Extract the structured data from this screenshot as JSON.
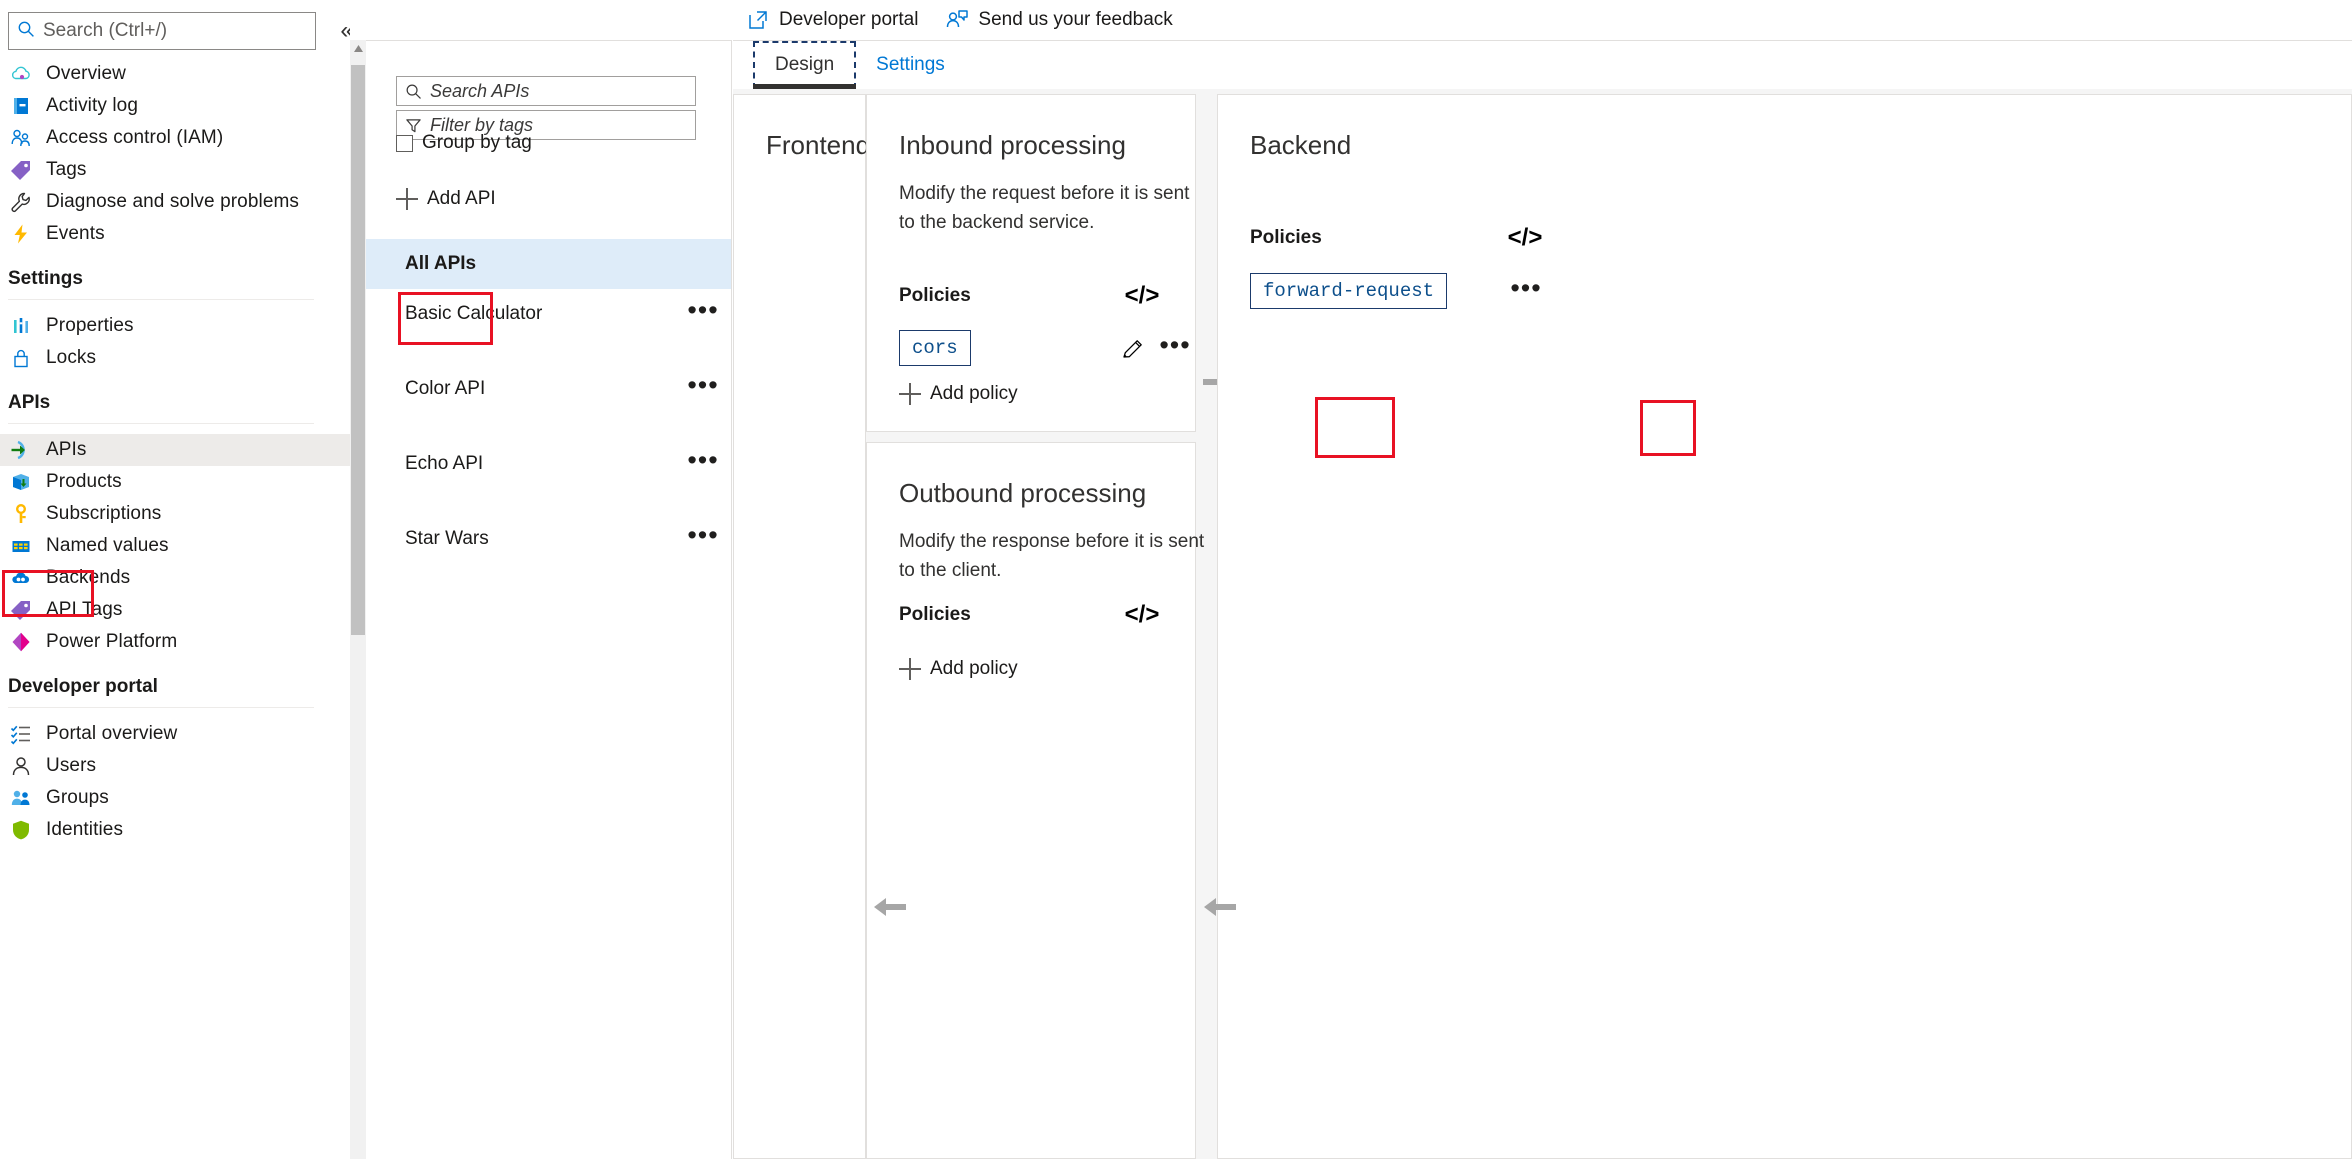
{
  "sidebar": {
    "search": {
      "placeholder": "Search (Ctrl+/)",
      "value": ""
    },
    "collapse_glyph": "«",
    "items": [
      {
        "label": "Overview",
        "icon": "cloud-overview-icon",
        "type": "item"
      },
      {
        "label": "Activity log",
        "icon": "activity-log-icon",
        "type": "item"
      },
      {
        "label": "Access control (IAM)",
        "icon": "access-control-icon",
        "type": "item"
      },
      {
        "label": "Tags",
        "icon": "tag-icon",
        "type": "item"
      },
      {
        "label": "Diagnose and solve problems",
        "icon": "wrench-icon",
        "type": "item"
      },
      {
        "label": "Events",
        "icon": "lightning-icon",
        "type": "item"
      },
      {
        "label": "Settings",
        "type": "group"
      },
      {
        "label": "Properties",
        "icon": "properties-icon",
        "type": "item"
      },
      {
        "label": "Locks",
        "icon": "lock-icon",
        "type": "item"
      },
      {
        "label": "APIs",
        "type": "group"
      },
      {
        "label": "APIs",
        "icon": "apis-icon",
        "type": "item",
        "selected": true
      },
      {
        "label": "Products",
        "icon": "products-icon",
        "type": "item"
      },
      {
        "label": "Subscriptions",
        "icon": "key-icon",
        "type": "item"
      },
      {
        "label": "Named values",
        "icon": "named-values-icon",
        "type": "item"
      },
      {
        "label": "Backends",
        "icon": "backends-cloud-icon",
        "type": "item"
      },
      {
        "label": "API Tags",
        "icon": "api-tag-icon",
        "type": "item"
      },
      {
        "label": "Power Platform",
        "icon": "power-platform-icon",
        "type": "item"
      },
      {
        "label": "Developer portal",
        "type": "group"
      },
      {
        "label": "Portal overview",
        "icon": "portal-overview-icon",
        "type": "item"
      },
      {
        "label": "Users",
        "icon": "user-icon",
        "type": "item"
      },
      {
        "label": "Groups",
        "icon": "groups-icon",
        "type": "item"
      },
      {
        "label": "Identities",
        "icon": "shield-icon",
        "type": "item"
      }
    ]
  },
  "toolbar": {
    "developer_portal_label": "Developer portal",
    "feedback_label": "Send us your feedback"
  },
  "tabs": [
    {
      "label": "Design",
      "active": true
    },
    {
      "label": "Settings",
      "active": false
    }
  ],
  "api_panel": {
    "search": {
      "placeholder": "Search APIs",
      "value": ""
    },
    "filter": {
      "placeholder": "Filter by tags",
      "value": ""
    },
    "group_by_tag_label": "Group by tag",
    "group_by_tag_checked": false,
    "add_api_label": "Add API",
    "all_apis_label": "All APIs",
    "apis": [
      {
        "name": "Basic Calculator"
      },
      {
        "name": "Color API"
      },
      {
        "name": "Echo API"
      },
      {
        "name": "Star Wars"
      }
    ],
    "menu_glyph": "•••"
  },
  "design": {
    "frontend": {
      "title": "Frontend"
    },
    "inbound": {
      "title": "Inbound processing",
      "description": "Modify the request before it is sent to the backend service.",
      "policies_label": "Policies",
      "policies": [
        {
          "name": "cors"
        }
      ],
      "add_policy_label": "Add policy"
    },
    "backend": {
      "title": "Backend",
      "policies_label": "Policies",
      "policies": [
        {
          "name": "forward-request"
        }
      ]
    },
    "outbound": {
      "title": "Outbound processing",
      "description": "Modify the response before it is sent to the client.",
      "policies_label": "Policies",
      "add_policy_label": "Add policy"
    },
    "code_icon_glyph": "</>",
    "menu_glyph": "•••"
  },
  "colors": {
    "annotation": "#e81123",
    "accent": "#0078d4",
    "selected_nav": "#edebe9",
    "selected_api": "#deecf9",
    "canvas": "#f5f5f5",
    "policy_chip_border": "#1b3a6b",
    "policy_chip_text": "#0d4f8b"
  }
}
